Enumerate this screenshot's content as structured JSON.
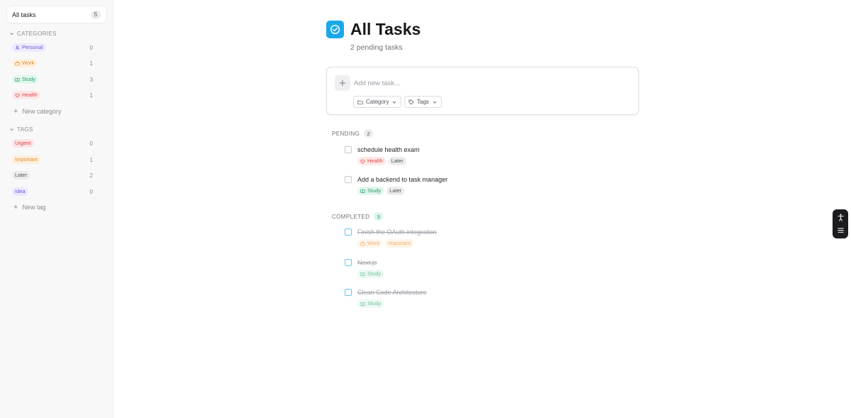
{
  "sidebar": {
    "all_tasks": {
      "label": "All tasks",
      "count": "5"
    },
    "categories_heading": "CATEGORIES",
    "categories": [
      {
        "label": "Personal",
        "count": "0",
        "icon": "user-icon",
        "color": "#6d5fd3"
      },
      {
        "label": "Work",
        "count": "1",
        "icon": "briefcase-icon",
        "color": "#e3872b"
      },
      {
        "label": "Study",
        "count": "3",
        "icon": "book-icon",
        "color": "#23a06a"
      },
      {
        "label": "Health",
        "count": "1",
        "icon": "heart-icon",
        "color": "#e04848"
      }
    ],
    "new_category_label": "New category",
    "tags_heading": "TAGS",
    "tags": [
      {
        "label": "Urgent",
        "count": "0",
        "color": "#dc3c3c"
      },
      {
        "label": "Important",
        "count": "1",
        "color": "#e48a2a"
      },
      {
        "label": "Later",
        "count": "2",
        "color": "#55555c"
      },
      {
        "label": "Idea",
        "count": "0",
        "color": "#6a5ad6"
      }
    ],
    "new_tag_label": "New tag"
  },
  "header": {
    "title": "All Tasks",
    "subtitle": "2 pending tasks",
    "icon": "check-circle-icon",
    "accent_color": "#1ba8e8"
  },
  "new_task": {
    "placeholder": "Add new task...",
    "category_label": "Category",
    "tags_label": "Tags"
  },
  "pending": {
    "heading": "PENDING",
    "count": "2",
    "tasks": [
      {
        "title": "schedule health exam",
        "category": "Health",
        "tags": [
          "Later"
        ]
      },
      {
        "title": "Add a backend to task manager",
        "category": "Study",
        "tags": [
          "Later"
        ]
      }
    ]
  },
  "completed": {
    "heading": "COMPLETED",
    "count": "3",
    "tasks": [
      {
        "title": "Finish the OAuth integration",
        "category": "Work",
        "tags": [
          "Important"
        ]
      },
      {
        "title": "Next.js",
        "category": "Study",
        "tags": []
      },
      {
        "title": "Clean Code Architecture",
        "category": "Study",
        "tags": []
      }
    ]
  }
}
